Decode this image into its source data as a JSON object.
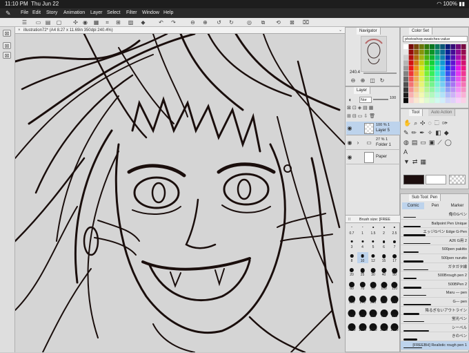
{
  "status": {
    "time": "11:10 PM",
    "date": "Thu Jun 22",
    "battery": "100%"
  },
  "menu": [
    "File",
    "Edit",
    "Story",
    "Animation",
    "Layer",
    "Select",
    "Filter",
    "Window",
    "Help"
  ],
  "document": {
    "title": "illustration72* (A4 8.27 x 11.69in 350dpi 240.4%)"
  },
  "navigator": {
    "label": "Navigator",
    "zoom": "240.4"
  },
  "colorset": {
    "label": "Color Set",
    "dropdown": "photoshop-swatches-value"
  },
  "layer_panel": {
    "label": "Layer",
    "blend": "Nor",
    "opacity": "100",
    "layers": [
      {
        "pct": "100 %",
        "mode": "1",
        "name": "Layer 5"
      },
      {
        "pct": "27 %",
        "mode": "1",
        "name": "Folder 1"
      },
      {
        "pct": "",
        "mode": "",
        "name": "Paper"
      }
    ]
  },
  "tool_panel": {
    "label": "Tool",
    "label2": "Auto Action"
  },
  "subtool": {
    "label": "Sub Tool: Pen",
    "tabs": [
      "Comic",
      "Pen",
      "Marker"
    ],
    "brushes": [
      "俺のGペン",
      "Ballpoint Pen Unique",
      "エッジGペン Edge G-Pen",
      "A26 G用 2",
      "500pen pakitto",
      "500pen nurutto",
      "ガタガタ線",
      "500Brough pen 2",
      "500BPen 2",
      "Maru — pen",
      "G— pen",
      "降るぎないアウトライン",
      "蛍光ペン",
      "シーペル",
      "きのペン",
      "[FREEBH] Realistic rough pen 1"
    ]
  },
  "brush_size": {
    "label": "Brush size",
    "label2": "[FREE",
    "values": [
      "0.7",
      "1",
      "1.5",
      "2",
      "2.5",
      "3",
      "4",
      "5",
      "6",
      "7",
      "8",
      "10",
      "12",
      "15",
      "17",
      "20",
      "25",
      "30",
      "40",
      "50",
      "60",
      "70",
      "80",
      "100",
      "120",
      "150",
      "170",
      "200",
      "250",
      "300",
      "400",
      "500",
      "600",
      "700",
      "800",
      "1000",
      "1200",
      "1500",
      "1700",
      "2000"
    ]
  }
}
